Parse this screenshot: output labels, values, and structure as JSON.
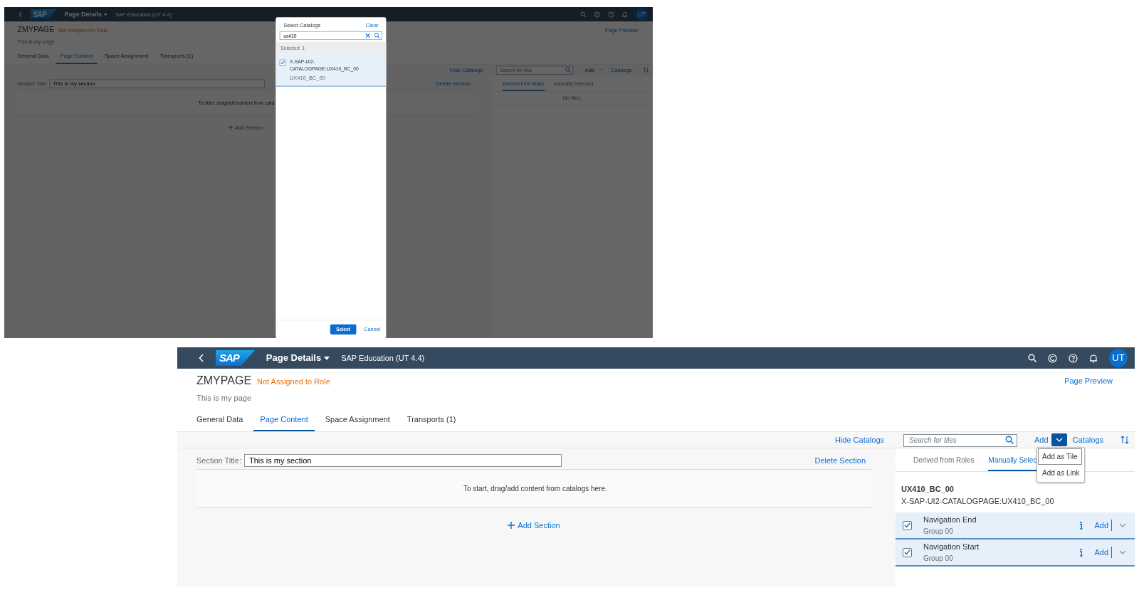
{
  "screens": [
    {
      "shell": {
        "logo": "SAP",
        "title": "Page Details",
        "subtitle": "SAP Education (UT 4.4)",
        "avatar": "UT"
      },
      "page": {
        "id": "ZMYPAGE",
        "status": "Not Assigned to Role",
        "description": "This is my page",
        "preview": "Page Preview"
      },
      "tabs": [
        {
          "label": "General Data",
          "selected": false
        },
        {
          "label": "Page Content",
          "selected": true
        },
        {
          "label": "Space Assignment",
          "selected": false
        },
        {
          "label": "Transports (1)",
          "selected": false
        }
      ],
      "toolbar": {
        "hide_catalogs": "Hide Catalogs",
        "search_placeholder": "Search for tiles",
        "add": "Add",
        "add_disabled": true,
        "add_expanded": false,
        "catalogs": "Catalogs"
      },
      "section": {
        "label": "Section Title:",
        "value": "This is my section",
        "delete": "Delete Section",
        "empty": "To start, drag/add content from cata",
        "add_section": "Add Section"
      },
      "catalog_tabs": [
        {
          "label": "Derived from Roles",
          "selected": true
        },
        {
          "label": "Manually Selected",
          "selected": false
        }
      ],
      "empty_text": "No tiles",
      "dialog": {
        "title": "Select Catalogs",
        "clear": "Clear",
        "search_value": "ux410",
        "selected_count": "Selected: 1",
        "items": [
          {
            "title": "X-SAP-UI2-CATALOGPAGE:UX410_BC_00",
            "subtitle": "UX410_BC_00",
            "checked": true,
            "selected": true
          }
        ],
        "ok": "Select",
        "cancel": "Cancel"
      }
    },
    {
      "shell": {
        "logo": "SAP",
        "title": "Page Details",
        "subtitle": "SAP Education (UT 4.4)",
        "avatar": "UT"
      },
      "page": {
        "id": "ZMYPAGE",
        "status": "Not Assigned to Role",
        "description": "This is my page",
        "preview": "Page Preview"
      },
      "tabs": [
        {
          "label": "General Data",
          "selected": false
        },
        {
          "label": "Page Content",
          "selected": true
        },
        {
          "label": "Space Assignment",
          "selected": false
        },
        {
          "label": "Transports (1)",
          "selected": false
        }
      ],
      "toolbar": {
        "hide_catalogs": "Hide Catalogs",
        "search_placeholder": "Search for tiles",
        "add": "Add",
        "add_disabled": false,
        "add_expanded": true,
        "catalogs": "Catalogs"
      },
      "section": {
        "label": "Section Title:",
        "value": "This is my section",
        "delete": "Delete Section",
        "empty": "To start, drag/add content from catalogs here.",
        "add_section": "Add Section"
      },
      "catalog_tabs": [
        {
          "label": "Derived from Roles",
          "selected": false
        },
        {
          "label": "Manually Selec",
          "selected": true
        }
      ],
      "catalog": {
        "name": "UX410_BC_00",
        "id": "X-SAP-UI2-CATALOGPAGE:UX410_BC_00",
        "tiles": [
          {
            "title": "Navigation End",
            "subtitle": "Group 00",
            "checked": true,
            "selected": true,
            "add": "Add"
          },
          {
            "title": "Navigation Start",
            "subtitle": "Group 00",
            "checked": true,
            "selected": true,
            "add": "Add"
          }
        ]
      },
      "menu": [
        {
          "label": "Add as Tile",
          "selected": true
        },
        {
          "label": "Add as Link",
          "selected": false
        }
      ]
    }
  ]
}
